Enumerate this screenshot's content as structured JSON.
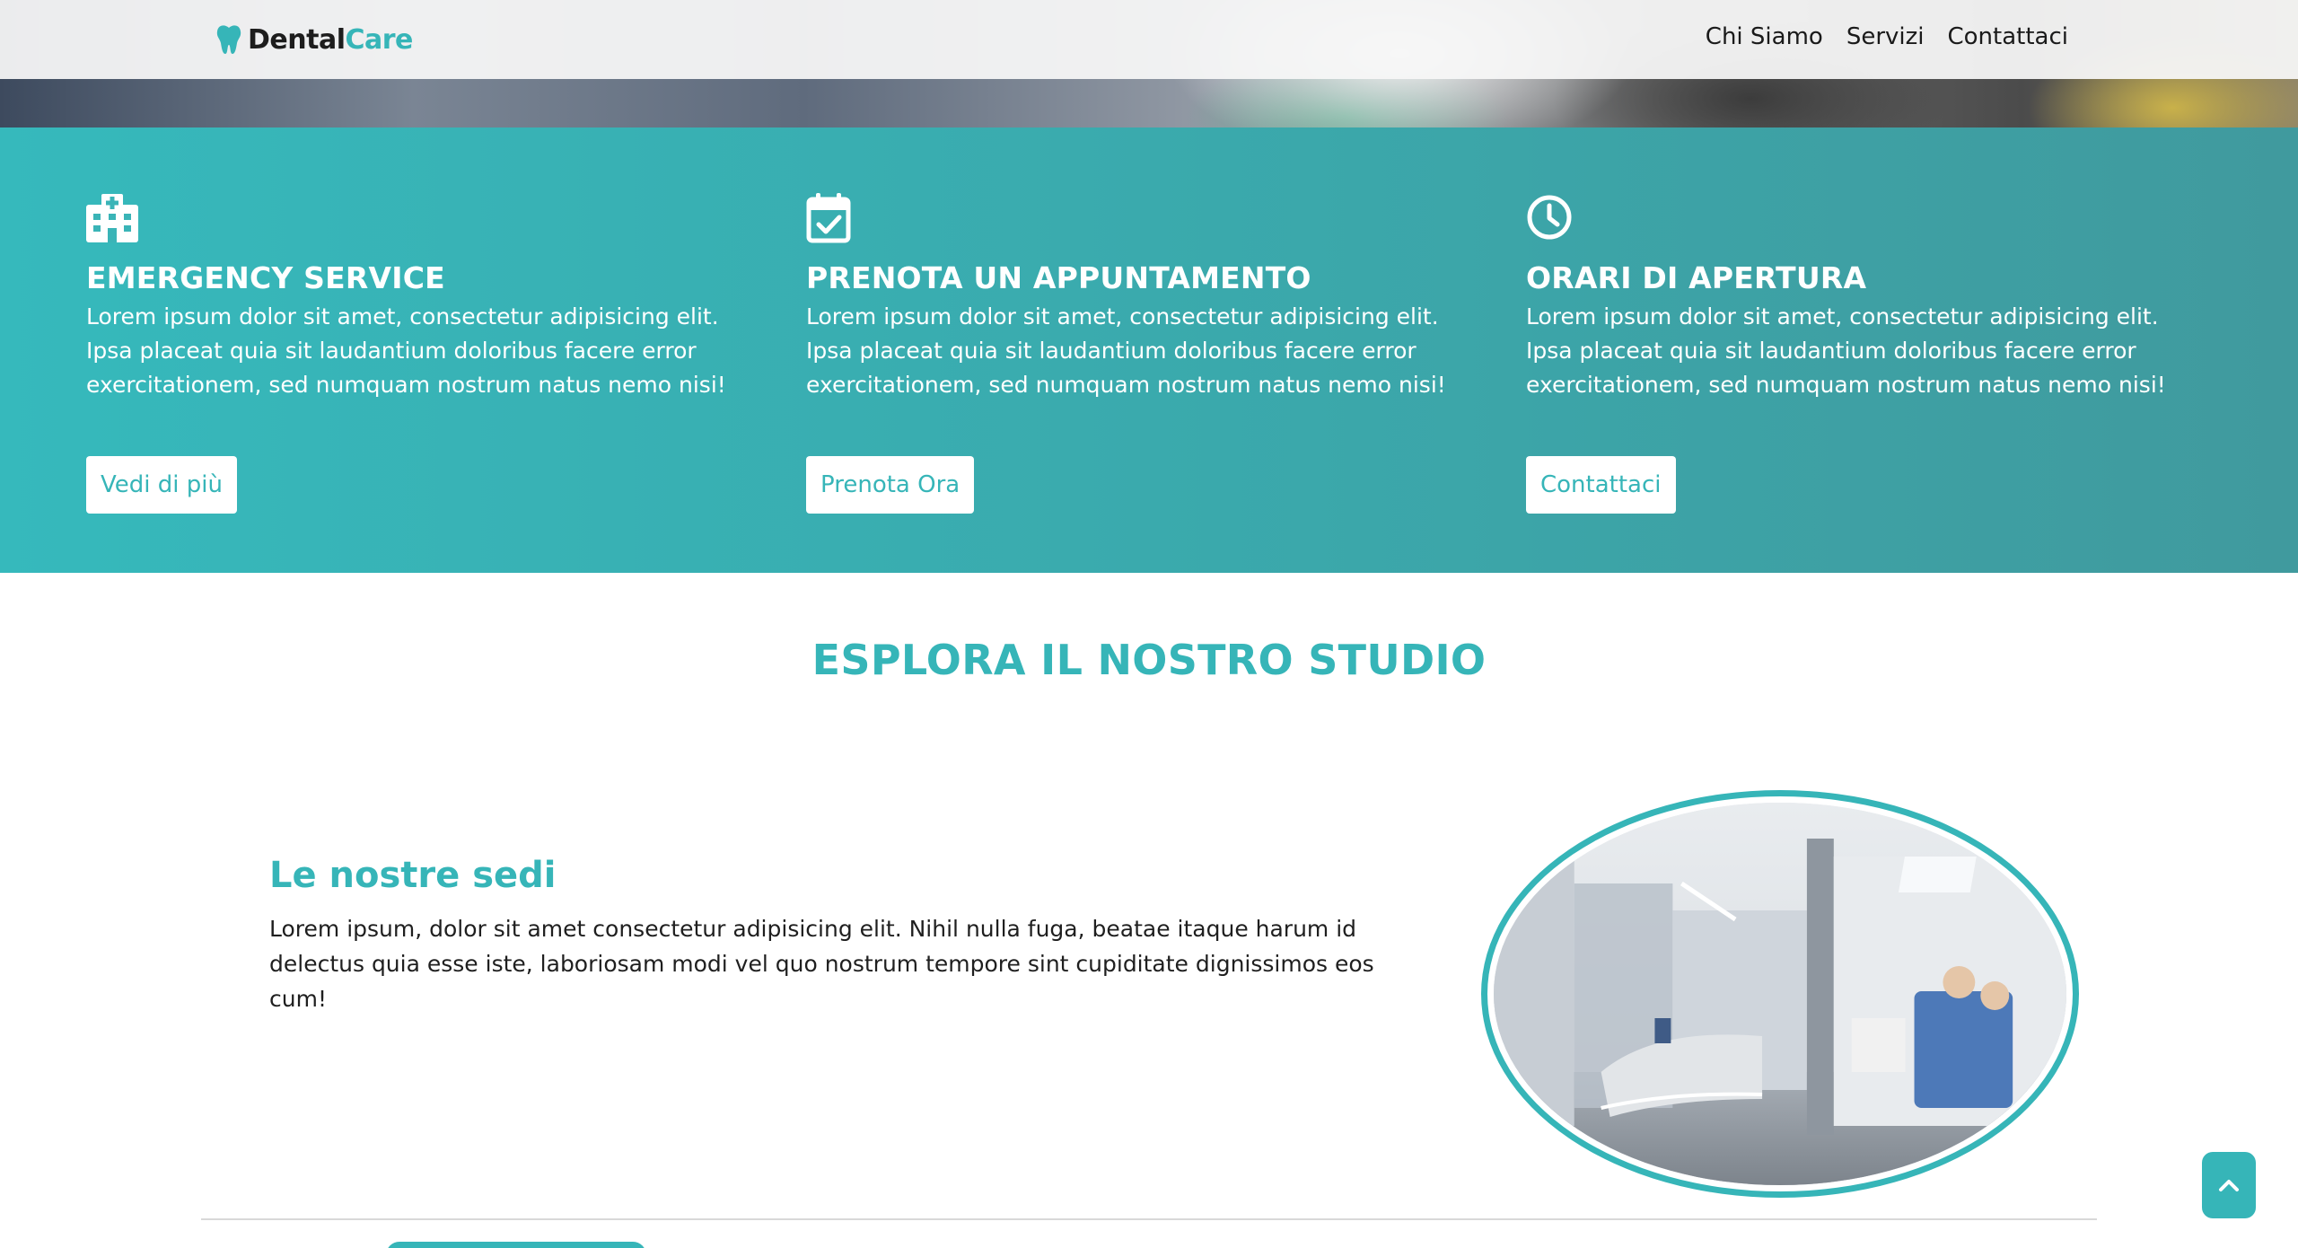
{
  "brand": {
    "name_part1": "Dental",
    "name_part2": "Care",
    "accent_color": "#36b5b8"
  },
  "nav": {
    "links": [
      {
        "label": "Chi Siamo"
      },
      {
        "label": "Servizi"
      },
      {
        "label": "Contattaci"
      }
    ]
  },
  "services": [
    {
      "icon": "hospital-icon",
      "title": "EMERGENCY SERVICE",
      "text": "Lorem ipsum dolor sit amet, consectetur adipisicing elit. Ipsa placeat quia sit laudantium doloribus facere error exercitationem, sed numquam nostrum natus nemo nisi!",
      "button": "Vedi di più"
    },
    {
      "icon": "calendar-check-icon",
      "title": "PRENOTA UN APPUNTAMENTO",
      "text": "Lorem ipsum dolor sit amet, consectetur adipisicing elit. Ipsa placeat quia sit laudantium doloribus facere error exercitationem, sed numquam nostrum natus nemo nisi!",
      "button": "Prenota Ora"
    },
    {
      "icon": "clock-icon",
      "title": "ORARI DI APERTURA",
      "text": "Lorem ipsum dolor sit amet, consectetur adipisicing elit. Ipsa placeat quia sit laudantium doloribus facere error exercitationem, sed numquam nostrum natus nemo nisi!",
      "button": "Contattaci"
    }
  ],
  "explore": {
    "title": "ESPLORA IL NOSTRO STUDIO",
    "sede_title": "Le nostre sedi",
    "sede_text": "Lorem ipsum, dolor sit amet consectetur adipisicing elit. Nihil nulla fuga, beatae itaque harum id delectus quia esse iste, laboriosam modi vel quo nostrum tempore sint cupiditate dignissimos eos cum!",
    "image": "dental-clinic-reception-photo"
  },
  "back_to_top": {
    "icon": "chevron-up-icon"
  }
}
